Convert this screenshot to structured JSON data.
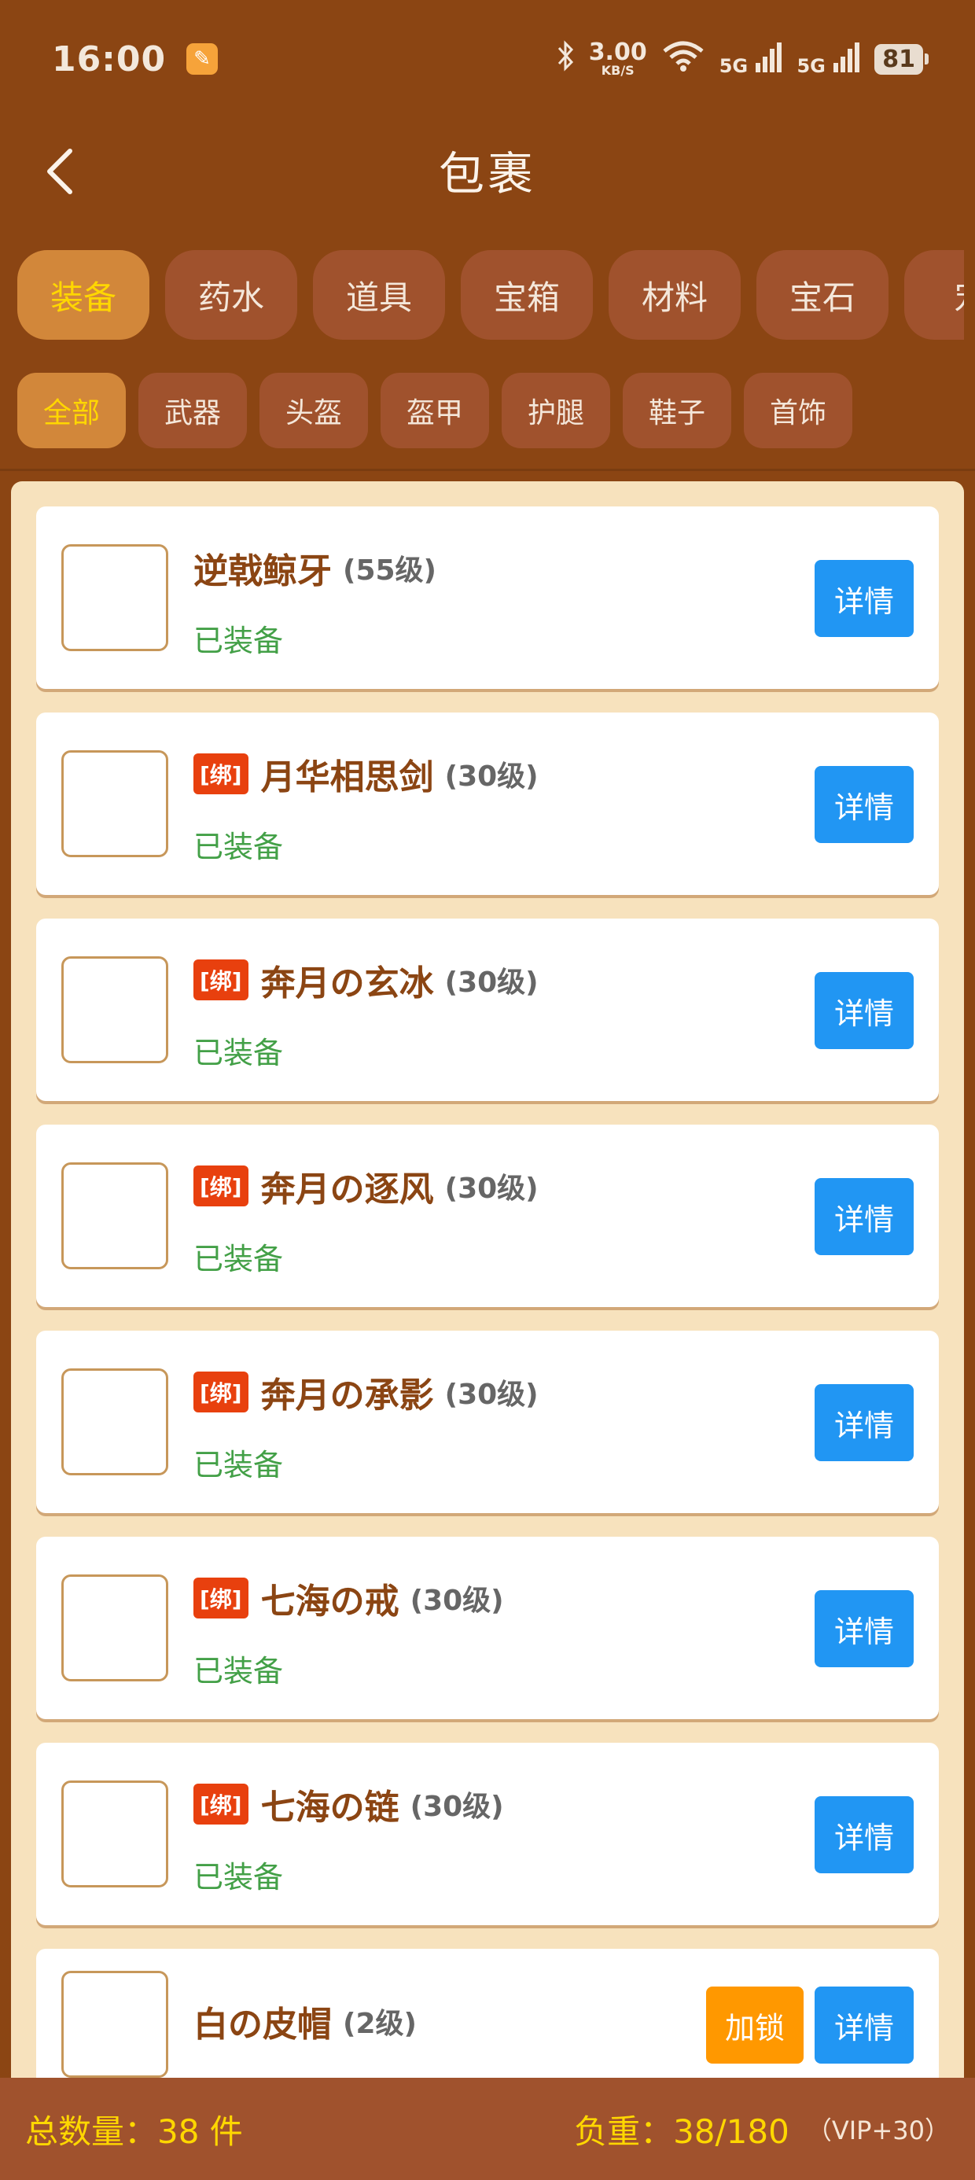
{
  "status_bar": {
    "time": "16:00",
    "speed_value": "3.00",
    "speed_unit": "KB/S",
    "net1": "5G",
    "net2": "5G",
    "battery": "81"
  },
  "header": {
    "title": "包裹"
  },
  "category_tabs": [
    "装备",
    "药水",
    "道具",
    "宝箱",
    "材料",
    "宝石",
    "宠"
  ],
  "sub_tabs": [
    "全部",
    "武器",
    "头盔",
    "盔甲",
    "护腿",
    "鞋子",
    "首饰"
  ],
  "items": [
    {
      "bind": "",
      "name": "逆戟鲸牙",
      "level": "(55级)",
      "status": "已装备",
      "detail": "详情",
      "lock": ""
    },
    {
      "bind": "[绑]",
      "name": "月华相思剑",
      "level": "(30级)",
      "status": "已装备",
      "detail": "详情",
      "lock": ""
    },
    {
      "bind": "[绑]",
      "name": "奔月の玄冰",
      "level": "(30级)",
      "status": "已装备",
      "detail": "详情",
      "lock": ""
    },
    {
      "bind": "[绑]",
      "name": "奔月の逐风",
      "level": "(30级)",
      "status": "已装备",
      "detail": "详情",
      "lock": ""
    },
    {
      "bind": "[绑]",
      "name": "奔月の承影",
      "level": "(30级)",
      "status": "已装备",
      "detail": "详情",
      "lock": ""
    },
    {
      "bind": "[绑]",
      "name": "七海の戒",
      "level": "(30级)",
      "status": "已装备",
      "detail": "详情",
      "lock": ""
    },
    {
      "bind": "[绑]",
      "name": "七海の链",
      "level": "(30级)",
      "status": "已装备",
      "detail": "详情",
      "lock": ""
    },
    {
      "bind": "",
      "name": "白の皮帽",
      "level": "(2级)",
      "status": "",
      "detail": "详情",
      "lock": "加锁"
    }
  ],
  "footer": {
    "total": "总数量：38 件",
    "weight": "负重：38/180",
    "vip": "（VIP+30）"
  },
  "colors": {
    "background": "#8B4513",
    "tab": "#A0522D",
    "tab_active": "#D2873A",
    "tab_active_text": "#FFD700",
    "detail_button": "#2196F3",
    "lock_button": "#FF9800",
    "bind_badge": "#E8400E",
    "equipped": "#43A047"
  }
}
